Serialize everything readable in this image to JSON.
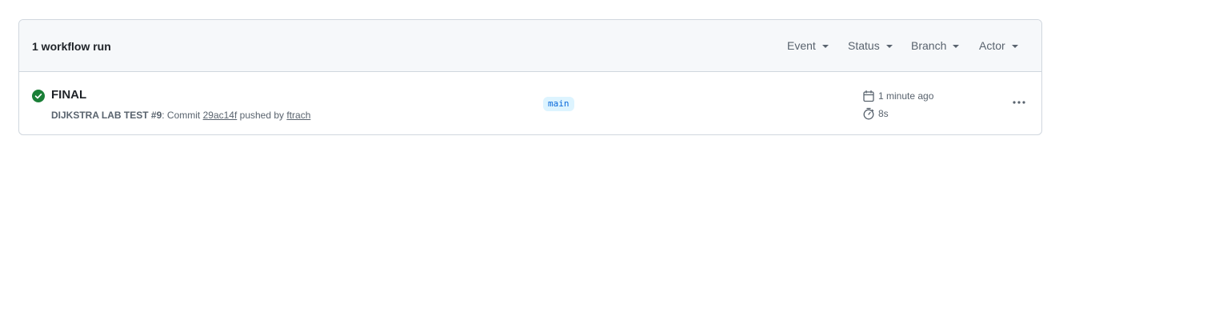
{
  "header": {
    "run_count": "1 workflow run",
    "filters": {
      "event": "Event",
      "status": "Status",
      "branch": "Branch",
      "actor": "Actor"
    }
  },
  "runs": [
    {
      "status": "success",
      "status_icon": "check-circle-fill-icon",
      "status_color": "#1a7f37",
      "title": "FINAL",
      "workflow": "DIJKSTRA LAB TEST",
      "run_number": "#9",
      "commit_prefix": ": Commit ",
      "commit_sha": "29ac14f",
      "pushed_by": " pushed by ",
      "actor": "ftrach",
      "branch": "main",
      "time_ago": "1 minute ago",
      "duration": "8s"
    }
  ]
}
